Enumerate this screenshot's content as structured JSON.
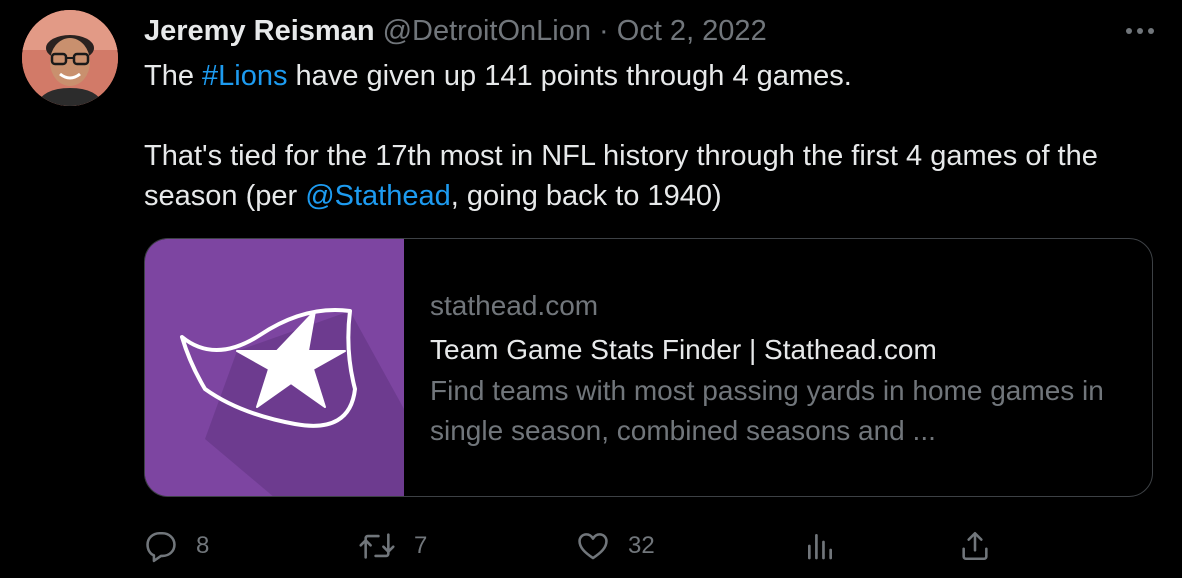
{
  "author": {
    "name": "Jeremy Reisman",
    "handle": "@DetroitOnLion",
    "separator": "·",
    "date": "Oct 2, 2022"
  },
  "tweet": {
    "p1_prefix": "The ",
    "p1_hashtag": "#Lions",
    "p1_suffix": " have given up 141 points through 4 games.",
    "p2_prefix": "That's tied for the 17th most in NFL history through the first 4 games of the season (per ",
    "p2_mention": "@Stathead",
    "p2_suffix": ", going back to 1940)"
  },
  "card": {
    "domain": "stathead.com",
    "title": "Team Game Stats Finder | Stathead.com",
    "description": "Find teams with most passing yards in home games in single season, combined seasons and ..."
  },
  "actions": {
    "replies": "8",
    "retweets": "7",
    "likes": "32"
  },
  "icons": {
    "reply": "reply-icon",
    "retweet": "retweet-icon",
    "like": "heart-icon",
    "views": "analytics-icon",
    "share": "share-icon",
    "more": "more-icon"
  },
  "colors": {
    "background": "#000000",
    "text": "#e7e9ea",
    "muted": "#71767b",
    "link": "#1d9bf0",
    "card_media": "#7d45a1",
    "border": "#3d4145"
  }
}
